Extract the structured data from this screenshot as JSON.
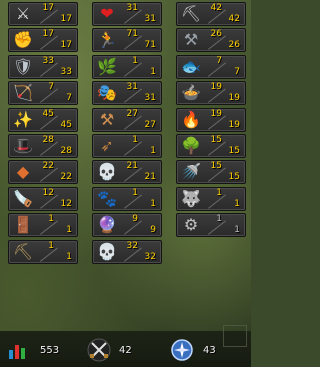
{
  "skills": [
    {
      "name": "Attack",
      "icon": "sword-icon",
      "glyph": "⚔",
      "color": "#d9d9d9",
      "current": "17",
      "max": "17"
    },
    {
      "name": "Constitution",
      "icon": "heart-icon",
      "glyph": "❤",
      "color": "#e02020",
      "current": "31",
      "max": "31"
    },
    {
      "name": "Mining",
      "icon": "pickaxe-icon",
      "glyph": "⛏",
      "color": "#cfcfcf",
      "current": "42",
      "max": "42"
    },
    {
      "name": "Strength",
      "icon": "fist-icon",
      "glyph": "✊",
      "color": "#d08040",
      "current": "17",
      "max": "17"
    },
    {
      "name": "Agility",
      "icon": "running-man-icon",
      "glyph": "🏃",
      "color": "#f0a020",
      "current": "71",
      "max": "71"
    },
    {
      "name": "Smithing",
      "icon": "anvil-icon",
      "glyph": "⚒",
      "color": "#9aa0a8",
      "current": "26",
      "max": "26"
    },
    {
      "name": "Defence",
      "icon": "shield-icon",
      "glyph": "🛡",
      "color": "#c0c8d0",
      "current": "33",
      "max": "33"
    },
    {
      "name": "Herblore",
      "icon": "herb-leaf-icon",
      "glyph": "🌿",
      "color": "#40c040",
      "current": "1",
      "max": "1"
    },
    {
      "name": "Fishing",
      "icon": "fish-icon",
      "glyph": "🐟",
      "color": "#a0c0d0",
      "current": "7",
      "max": "7"
    },
    {
      "name": "Ranged",
      "icon": "bow-icon",
      "glyph": "🏹",
      "color": "#80a050",
      "current": "7",
      "max": "7"
    },
    {
      "name": "Thieving",
      "icon": "mask-icon",
      "glyph": "🎭",
      "color": "#d0d0d0",
      "current": "31",
      "max": "31"
    },
    {
      "name": "Cooking",
      "icon": "cooking-pot-icon",
      "glyph": "🍲",
      "color": "#e07020",
      "current": "19",
      "max": "19"
    },
    {
      "name": "Prayer",
      "icon": "prayer-star-icon",
      "glyph": "✨",
      "color": "#c0f0ff",
      "current": "45",
      "max": "45"
    },
    {
      "name": "Crafting",
      "icon": "chisel-icon",
      "glyph": "⚒",
      "color": "#d09050",
      "current": "27",
      "max": "27"
    },
    {
      "name": "Firemaking",
      "icon": "fire-icon",
      "glyph": "🔥",
      "color": "#ff7010",
      "current": "19",
      "max": "19"
    },
    {
      "name": "Magic",
      "icon": "wizard-hat-icon",
      "glyph": "🎩",
      "color": "#4060d0",
      "current": "28",
      "max": "28"
    },
    {
      "name": "Fletching",
      "icon": "arrows-icon",
      "glyph": "➶",
      "color": "#c08040",
      "current": "1",
      "max": "1"
    },
    {
      "name": "Woodcutting",
      "icon": "tree-icon",
      "glyph": "🌳",
      "color": "#40a030",
      "current": "15",
      "max": "15"
    },
    {
      "name": "Runecrafting",
      "icon": "rune-icon",
      "glyph": "◆",
      "color": "#e07030",
      "current": "22",
      "max": "22"
    },
    {
      "name": "Slayer",
      "icon": "skull-helm-icon",
      "glyph": "💀",
      "color": "#c0b090",
      "current": "21",
      "max": "21"
    },
    {
      "name": "Farming",
      "icon": "watering-can-icon",
      "glyph": "🚿",
      "color": "#b0b0b0",
      "current": "15",
      "max": "15"
    },
    {
      "name": "Construction",
      "icon": "saw-icon",
      "glyph": "🪚",
      "color": "#c09050",
      "current": "12",
      "max": "12"
    },
    {
      "name": "Hunter",
      "icon": "paw-icon",
      "glyph": "🐾",
      "color": "#b08040",
      "current": "1",
      "max": "1"
    },
    {
      "name": "Summoning",
      "icon": "wolf-pouch-icon",
      "glyph": "🐺",
      "color": "#e0e0e0",
      "current": "1",
      "max": "1"
    },
    {
      "name": "Dungeoneering",
      "icon": "dungeon-door-icon",
      "glyph": "🚪",
      "color": "#f0a030",
      "current": "1",
      "max": "1"
    },
    {
      "name": "Divination",
      "icon": "orb-icon",
      "glyph": "🔮",
      "color": "#60a0ff",
      "current": "9",
      "max": "9"
    },
    {
      "name": "Invention",
      "icon": "gizmo-icon",
      "glyph": "⚙",
      "color": "#c0c0c0",
      "current": "1",
      "max": "1",
      "locked": true
    },
    {
      "name": "Archaeology",
      "icon": "trowel-icon",
      "glyph": "⛏",
      "color": "#c0a060",
      "current": "1",
      "max": "1"
    },
    {
      "name": "Necromancy",
      "icon": "skull-icon",
      "glyph": "💀",
      "color": "#e0e0c0",
      "current": "32",
      "max": "32"
    }
  ],
  "footer": {
    "total_level": "553",
    "combat_level": "42",
    "quest_points": "43"
  }
}
